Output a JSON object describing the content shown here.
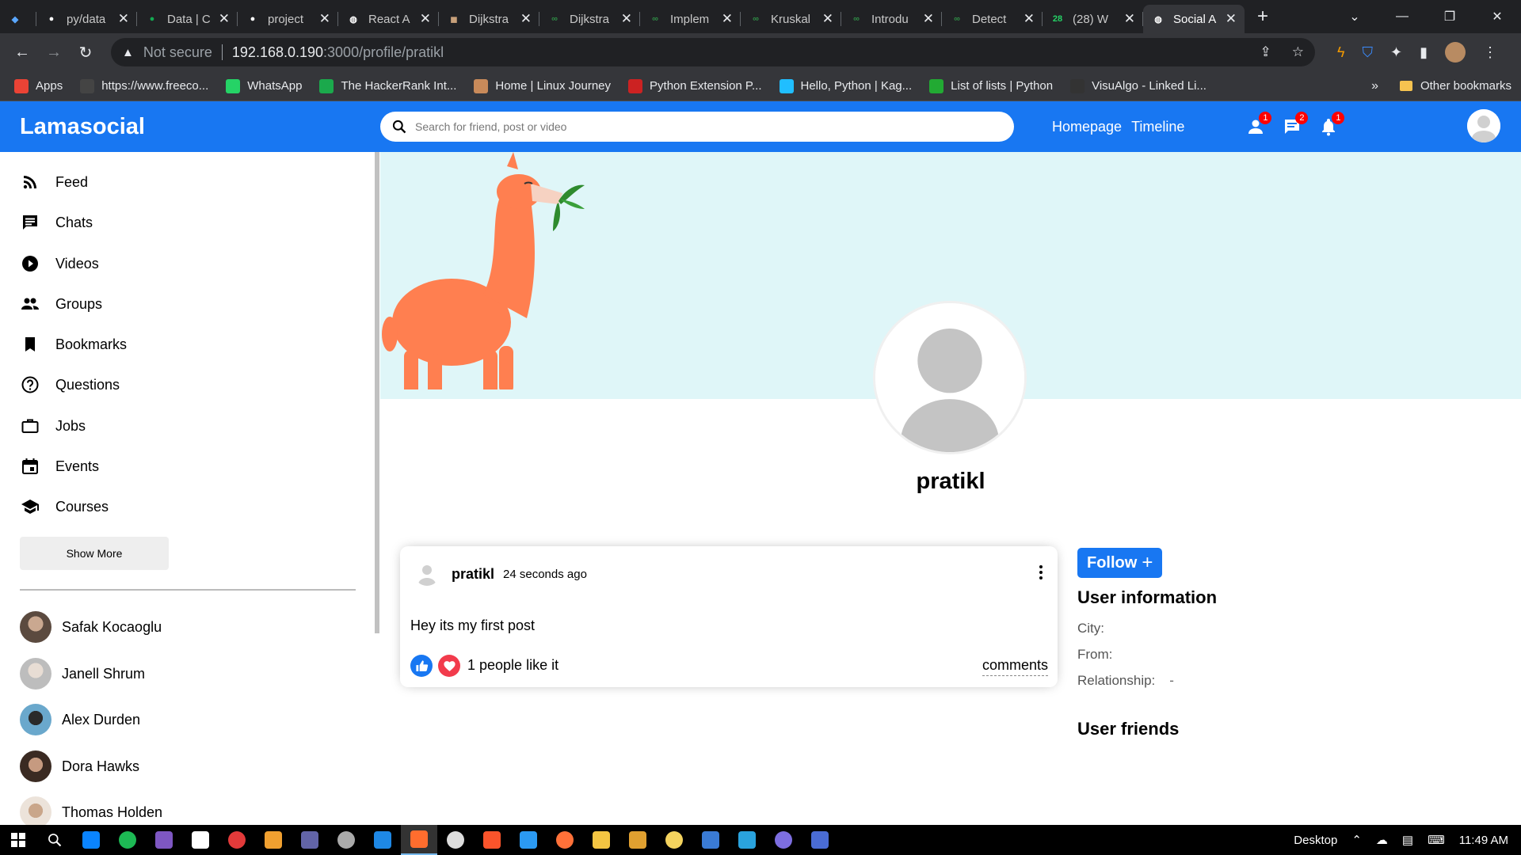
{
  "browser": {
    "tabs": [
      {
        "title": "",
        "color": "#5aa7ff",
        "glyph": "◆"
      },
      {
        "title": "py/data",
        "color": "#ffffff",
        "glyph": "●"
      },
      {
        "title": "Data | C",
        "color": "#13aa52",
        "glyph": "●"
      },
      {
        "title": "project",
        "color": "#ffffff",
        "glyph": "●"
      },
      {
        "title": "React A",
        "color": "#ffffff",
        "glyph": "◍"
      },
      {
        "title": "Dijkstra",
        "color": "#c8a07a",
        "glyph": "◼"
      },
      {
        "title": "Dijkstra",
        "color": "#2f8d46",
        "glyph": "∞"
      },
      {
        "title": "Implem",
        "color": "#2f8d46",
        "glyph": "∞"
      },
      {
        "title": "Kruskal",
        "color": "#2f8d46",
        "glyph": "∞"
      },
      {
        "title": "Introdu",
        "color": "#2f8d46",
        "glyph": "∞"
      },
      {
        "title": "Detect",
        "color": "#2f8d46",
        "glyph": "∞"
      },
      {
        "title": "(28) W",
        "color": "#25d366",
        "glyph": "28"
      },
      {
        "title": "Social A",
        "color": "#ffffff",
        "glyph": "◍",
        "active": true
      }
    ],
    "address": {
      "security_label": "Not secure",
      "host": "192.168.0.190",
      "path": ":3000/profile/pratikl"
    },
    "bookmarks": [
      {
        "label": "Apps",
        "color": "#ea4335"
      },
      {
        "label": "https://www.freeco...",
        "color": "#444444"
      },
      {
        "label": "WhatsApp",
        "color": "#25d366"
      },
      {
        "label": "The HackerRank Int...",
        "color": "#1ba94c"
      },
      {
        "label": "Home | Linux Journey",
        "color": "#c88a5a"
      },
      {
        "label": "Python Extension P...",
        "color": "#cc2222"
      },
      {
        "label": "Hello, Python | Kag...",
        "color": "#20beff"
      },
      {
        "label": "List of lists | Python",
        "color": "#22aa33"
      },
      {
        "label": "VisuAlgo - Linked Li...",
        "color": "#333333"
      }
    ],
    "bookmarks_more": "»",
    "other_bookmarks": "Other bookmarks"
  },
  "app": {
    "logo": "Lamasocial",
    "search_placeholder": "Search for friend, post or video",
    "links": [
      "Homepage",
      "Timeline"
    ],
    "badges": {
      "friends": "1",
      "messages": "2",
      "notifications": "1"
    },
    "brand_color": "#1877f2"
  },
  "sidebar": {
    "items": [
      {
        "label": "Feed",
        "icon": "rss-icon"
      },
      {
        "label": "Chats",
        "icon": "chat-icon"
      },
      {
        "label": "Videos",
        "icon": "play-circle-icon"
      },
      {
        "label": "Groups",
        "icon": "group-icon"
      },
      {
        "label": "Bookmarks",
        "icon": "bookmark-icon"
      },
      {
        "label": "Questions",
        "icon": "help-circle-icon"
      },
      {
        "label": "Jobs",
        "icon": "work-outline-icon"
      },
      {
        "label": "Events",
        "icon": "event-icon"
      },
      {
        "label": "Courses",
        "icon": "school-icon"
      }
    ],
    "show_more": "Show More",
    "friends": [
      {
        "name": "Safak Kocaoglu",
        "color": "#6d5a4a"
      },
      {
        "name": "Janell Shrum",
        "color": "#cfcfcf"
      },
      {
        "name": "Alex Durden",
        "color": "#4a86a8"
      },
      {
        "name": "Dora Hawks",
        "color": "#8a5a48"
      },
      {
        "name": "Thomas Holden",
        "color": "#d8c8b8"
      }
    ]
  },
  "profile": {
    "name": "pratikl"
  },
  "post": {
    "username": "pratikl",
    "time": "24 seconds ago",
    "text": "Hey its my first post",
    "likes": "1 people like it",
    "comments": "comments"
  },
  "rightbar": {
    "follow_label": "Follow",
    "info_title": "User information",
    "info": [
      {
        "key": "City:",
        "value": ""
      },
      {
        "key": "From:",
        "value": ""
      },
      {
        "key": "Relationship:",
        "value": "-"
      }
    ],
    "friends_title": "User friends"
  },
  "taskbar": {
    "apps": [
      "#0a84ff",
      "#1db954",
      "#7e57c2",
      "#ffffff",
      "#e23a3a",
      "#f0a030",
      "#6264a7",
      "#aaaaaa",
      "#1e88e5",
      "#ff6d2e",
      "#dddddd",
      "#fb542b",
      "#2b9af3",
      "#ff7139",
      "#f4c542",
      "#e0a030",
      "#f4d35e",
      "#3a7bd5",
      "#2aa3de",
      "#7d6ee0",
      "#4a6cd4"
    ],
    "tray_label": "Desktop",
    "time": "11:49 AM"
  }
}
